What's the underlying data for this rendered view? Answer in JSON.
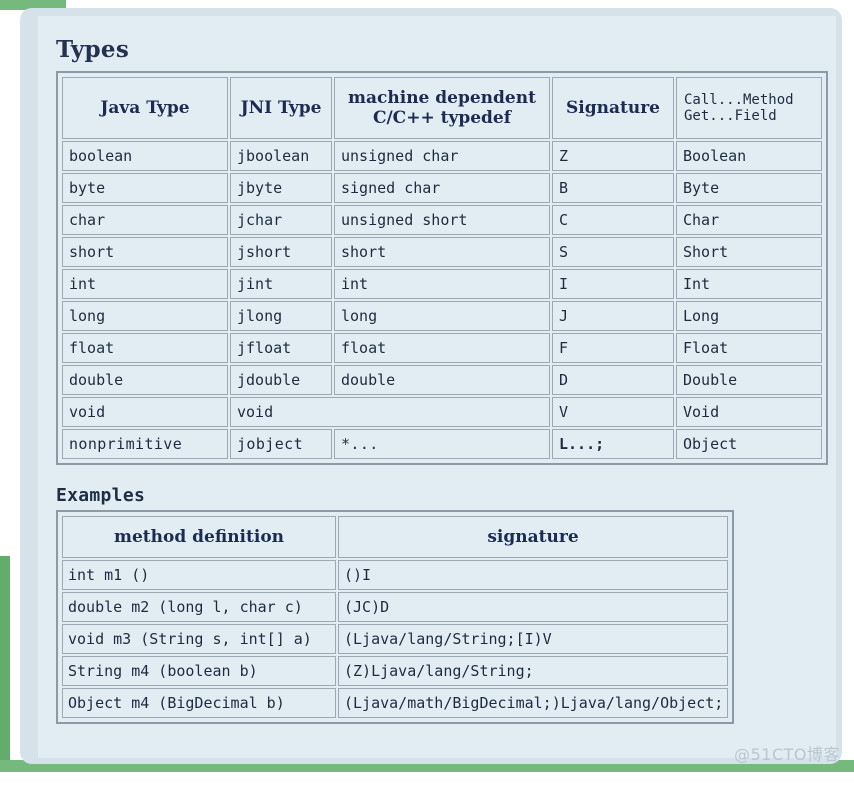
{
  "sections": {
    "types_title": "Types",
    "examples_title": "Examples"
  },
  "colors": {
    "page_background": "#ffffff",
    "card_outer": "#d5e2ea",
    "card_inner": "#e2edf3",
    "accent_green": "#76b97d",
    "accent_green_dark": "#63ac6b",
    "table_border": "#8a9aa6",
    "cell_border": "#9aa9b4",
    "header_text": "#1b2b52",
    "body_text": "#1d2b40",
    "watermark": "#b9c6cf"
  },
  "types_table": {
    "headers": [
      "Java Type",
      "JNI Type",
      "machine dependent\nC/C++ typedef",
      "Signature",
      "Call...Method\nGet...Field"
    ],
    "header_lines": {
      "machine_dependent_line1": "machine dependent",
      "machine_dependent_line2": "C/C++ typedef",
      "call_get_line1": "Call...Method",
      "call_get_line2": "Get...Field"
    },
    "rows": [
      {
        "java_type": "boolean",
        "jni_type": "jboolean",
        "typedef": "unsigned char",
        "signature": "Z",
        "accessor": "Boolean"
      },
      {
        "java_type": "byte",
        "jni_type": "jbyte",
        "typedef": "signed char",
        "signature": "B",
        "accessor": "Byte"
      },
      {
        "java_type": "char",
        "jni_type": "jchar",
        "typedef": "unsigned short",
        "signature": "C",
        "accessor": "Char"
      },
      {
        "java_type": "short",
        "jni_type": "jshort",
        "typedef": "short",
        "signature": "S",
        "accessor": "Short"
      },
      {
        "java_type": "int",
        "jni_type": "jint",
        "typedef": "int",
        "signature": "I",
        "accessor": "Int"
      },
      {
        "java_type": "long",
        "jni_type": "jlong",
        "typedef": "long",
        "signature": "J",
        "accessor": "Long"
      },
      {
        "java_type": "float",
        "jni_type": "jfloat",
        "typedef": "float",
        "signature": "F",
        "accessor": "Float"
      },
      {
        "java_type": "double",
        "jni_type": "jdouble",
        "typedef": "double",
        "signature": "D",
        "accessor": "Double"
      },
      {
        "java_type": "void",
        "jni_type": "void",
        "typedef": "",
        "signature": "V",
        "accessor": "Void",
        "merge_jni_typedef": true
      },
      {
        "java_type": "nonprimitive",
        "jni_type": "jobject",
        "typedef": "*...",
        "signature": "L...;",
        "accessor": "Object",
        "emphasize": true
      }
    ]
  },
  "examples_table": {
    "headers": [
      "method definition",
      "signature"
    ],
    "rows": [
      {
        "method": "int m1 ()",
        "signature": "()I"
      },
      {
        "method": "double m2 (long l, char c)",
        "signature": "(JC)D"
      },
      {
        "method": "void m3 (String s, int[] a)",
        "signature": "(Ljava/lang/String;[I)V"
      },
      {
        "method": "String m4 (boolean b)",
        "signature": "(Z)Ljava/lang/String;"
      },
      {
        "method": "Object m4 (BigDecimal b)",
        "signature": "(Ljava/math/BigDecimal;)Ljava/lang/Object;"
      }
    ]
  },
  "watermark": "@51CTO博客"
}
